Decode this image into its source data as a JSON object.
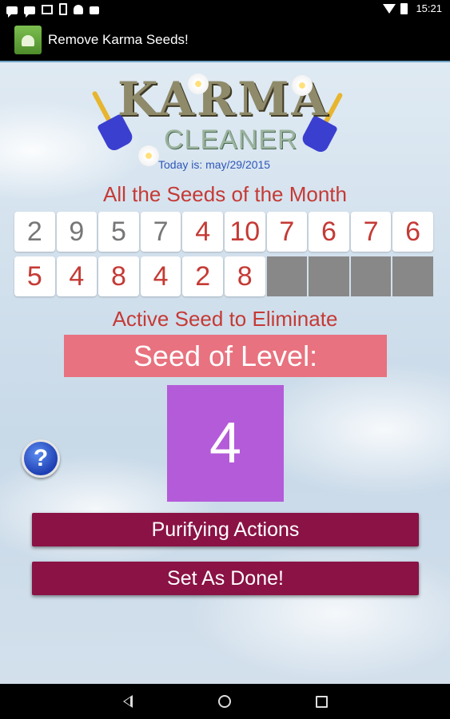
{
  "status_bar": {
    "time": "15:21"
  },
  "app_bar": {
    "title": "Remove Karma Seeds!"
  },
  "logo": {
    "line1": "KARMA",
    "line2": "CLEANER",
    "today": "Today is: may/29/2015"
  },
  "seeds": {
    "title": "All the Seeds of the Month",
    "row1": [
      "2",
      "9",
      "5",
      "7",
      "4",
      "10",
      "7",
      "6",
      "7",
      "6"
    ],
    "row2": [
      "5",
      "4",
      "8",
      "4",
      "2",
      "8",
      "",
      "",
      "",
      ""
    ]
  },
  "active": {
    "title": "Active Seed to Eliminate",
    "level_label": "Seed of Level:",
    "level_value": "4"
  },
  "buttons": {
    "help": "?",
    "purifying": "Purifying Actions",
    "done": "Set As Done!"
  },
  "colors": {
    "accent_red": "#c53a35",
    "button_bg": "#8a1245",
    "level_box": "#b45bd9",
    "banner": "#e8727f"
  }
}
